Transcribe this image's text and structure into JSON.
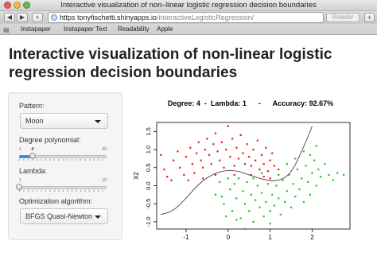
{
  "window": {
    "title": "Interactive visualization of non–linear logistic regression decision boundaries"
  },
  "toolbar": {
    "back": "◀",
    "forward": "▶",
    "url_host": "https  tonyfischetti.shinyapps.io",
    "url_path": "/interactiveLogisticRegression/",
    "reader": "Reader",
    "plus": "+"
  },
  "bookmarks": {
    "items": [
      "Instapaper",
      "Instapaper Text",
      "Readability",
      "Apple"
    ],
    "icon": "book-icon"
  },
  "page": {
    "title": "Interactive visualization of non-linear logistic regression decision boundaries"
  },
  "controls": {
    "pattern_label": "Pattern:",
    "pattern_value": "Moon",
    "degree_label": "Degree polynomial:",
    "degree": {
      "min": "1",
      "value": "4",
      "max": "20",
      "min_n": 1,
      "value_n": 4,
      "max_n": 20
    },
    "lambda_label": "Lambda:",
    "lambda": {
      "min": "1",
      "value": "1",
      "max": "10",
      "min_n": 1,
      "value_n": 1,
      "max_n": 10
    },
    "algorithm_label": "Optimization algorithm:",
    "algorithm_value": "BFGS Quasi-Newton"
  },
  "chart_data": {
    "type": "scatter",
    "title": "Degree: 4  -  Lambda: 1      -      Accuracy: 92.67%",
    "ylabel": "X2",
    "xlim": [
      -1.7,
      2.9
    ],
    "ylim": [
      -1.2,
      1.75
    ],
    "xticks": [
      -1,
      0,
      1,
      2
    ],
    "yticks": [
      -1.0,
      -0.5,
      0.0,
      0.5,
      1.0,
      1.5
    ],
    "ytick_labels": [
      "-1.0",
      "-0.5",
      "0.0",
      "0.5",
      "1.0",
      "1.5"
    ],
    "colors": {
      "class0": "#e41a1c",
      "class1": "#1fc41f",
      "boundary": "#444444"
    },
    "series": [
      {
        "values": [
          [
            -1.6,
            0.85
          ],
          [
            -1.52,
            0.45
          ],
          [
            -1.45,
            0.25
          ],
          [
            -1.3,
            0.7
          ],
          [
            -1.2,
            0.95
          ],
          [
            -1.15,
            0.5
          ],
          [
            -1.05,
            0.3
          ],
          [
            -1.0,
            0.8
          ],
          [
            -0.9,
            1.05
          ],
          [
            -0.85,
            0.6
          ],
          [
            -0.8,
            0.35
          ],
          [
            -0.75,
            0.9
          ],
          [
            -0.7,
            1.2
          ],
          [
            -0.65,
            0.7
          ],
          [
            -0.6,
            0.5
          ],
          [
            -0.55,
            1.0
          ],
          [
            -0.5,
            1.3
          ],
          [
            -0.45,
            0.85
          ],
          [
            -0.4,
            0.6
          ],
          [
            -0.35,
            1.15
          ],
          [
            -0.3,
            1.45
          ],
          [
            -0.25,
            0.95
          ],
          [
            -0.2,
            0.7
          ],
          [
            -0.15,
            1.2
          ],
          [
            -0.1,
            0.5
          ],
          [
            -0.05,
            1.0
          ],
          [
            0.0,
            1.65
          ],
          [
            0.05,
            0.8
          ],
          [
            0.1,
            1.3
          ],
          [
            0.15,
            0.55
          ],
          [
            0.2,
            1.05
          ],
          [
            0.25,
            0.75
          ],
          [
            0.3,
            1.4
          ],
          [
            0.35,
            0.9
          ],
          [
            0.4,
            0.6
          ],
          [
            0.45,
            1.15
          ],
          [
            0.5,
            0.8
          ],
          [
            0.55,
            0.55
          ],
          [
            0.6,
            1.0
          ],
          [
            0.65,
            0.7
          ],
          [
            0.7,
            1.25
          ],
          [
            0.75,
            0.45
          ],
          [
            0.8,
            0.85
          ],
          [
            0.85,
            0.6
          ],
          [
            0.9,
            1.05
          ],
          [
            0.95,
            0.4
          ],
          [
            1.0,
            0.7
          ],
          [
            1.05,
            0.9
          ],
          [
            1.1,
            0.55
          ],
          [
            1.2,
            0.45
          ],
          [
            -1.35,
            0.15
          ],
          [
            -0.95,
            0.15
          ],
          [
            -0.6,
            0.2
          ],
          [
            -0.3,
            0.3
          ],
          [
            0.15,
            0.3
          ],
          [
            0.55,
            0.3
          ],
          [
            0.85,
            0.25
          ],
          [
            1.0,
            0.2
          ]
        ]
      },
      {
        "values": [
          [
            -0.3,
            -0.25
          ],
          [
            -0.2,
            0.1
          ],
          [
            -0.1,
            -0.5
          ],
          [
            0.0,
            0.2
          ],
          [
            0.05,
            -0.1
          ],
          [
            0.1,
            -0.7
          ],
          [
            0.15,
            0.05
          ],
          [
            0.2,
            -0.35
          ],
          [
            0.25,
            0.2
          ],
          [
            0.3,
            -0.9
          ],
          [
            0.35,
            -0.15
          ],
          [
            0.4,
            -0.5
          ],
          [
            0.45,
            0.1
          ],
          [
            0.5,
            -0.7
          ],
          [
            0.55,
            -0.25
          ],
          [
            0.6,
            -1.0
          ],
          [
            0.65,
            -0.4
          ],
          [
            0.7,
            0.0
          ],
          [
            0.75,
            -0.6
          ],
          [
            0.8,
            -0.2
          ],
          [
            0.85,
            -0.85
          ],
          [
            0.9,
            -0.45
          ],
          [
            0.95,
            0.05
          ],
          [
            1.0,
            -0.7
          ],
          [
            1.05,
            -0.25
          ],
          [
            1.1,
            -0.55
          ],
          [
            1.15,
            0.0
          ],
          [
            1.2,
            -0.35
          ],
          [
            1.25,
            -0.8
          ],
          [
            1.3,
            0.15
          ],
          [
            1.35,
            -0.45
          ],
          [
            1.4,
            -0.15
          ],
          [
            1.45,
            0.3
          ],
          [
            1.5,
            -0.6
          ],
          [
            1.55,
            0.05
          ],
          [
            1.6,
            -0.3
          ],
          [
            1.65,
            0.45
          ],
          [
            1.7,
            -0.1
          ],
          [
            1.75,
            0.2
          ],
          [
            1.8,
            -0.45
          ],
          [
            1.85,
            0.55
          ],
          [
            1.9,
            0.1
          ],
          [
            1.95,
            -0.25
          ],
          [
            2.0,
            0.35
          ],
          [
            2.05,
            0.7
          ],
          [
            2.1,
            0.0
          ],
          [
            2.15,
            0.45
          ],
          [
            2.2,
            0.25
          ],
          [
            2.3,
            0.6
          ],
          [
            2.4,
            0.3
          ],
          [
            2.5,
            0.15
          ],
          [
            2.6,
            0.35
          ],
          [
            2.75,
            0.3
          ],
          [
            1.8,
            0.95
          ],
          [
            1.95,
            0.85
          ],
          [
            2.1,
            1.1
          ],
          [
            1.0,
            -1.05
          ],
          [
            0.4,
            -1.2
          ],
          [
            0.2,
            -0.95
          ],
          [
            -0.05,
            -0.85
          ],
          [
            0.6,
            0.2
          ],
          [
            0.8,
            0.35
          ],
          [
            1.2,
            0.3
          ],
          [
            1.4,
            0.6
          ],
          [
            1.6,
            0.75
          ],
          [
            -0.15,
            -0.3
          ]
        ]
      }
    ],
    "boundary": [
      [
        -1.6,
        -0.8
      ],
      [
        -1.3,
        -0.7
      ],
      [
        -1.0,
        -0.35
      ],
      [
        -0.7,
        0.05
      ],
      [
        -0.4,
        0.3
      ],
      [
        -0.1,
        0.42
      ],
      [
        0.2,
        0.42
      ],
      [
        0.5,
        0.3
      ],
      [
        0.8,
        0.18
      ],
      [
        1.1,
        0.12
      ],
      [
        1.35,
        0.2
      ],
      [
        1.55,
        0.45
      ],
      [
        1.75,
        0.95
      ],
      [
        1.9,
        1.35
      ],
      [
        2.0,
        1.65
      ]
    ]
  }
}
